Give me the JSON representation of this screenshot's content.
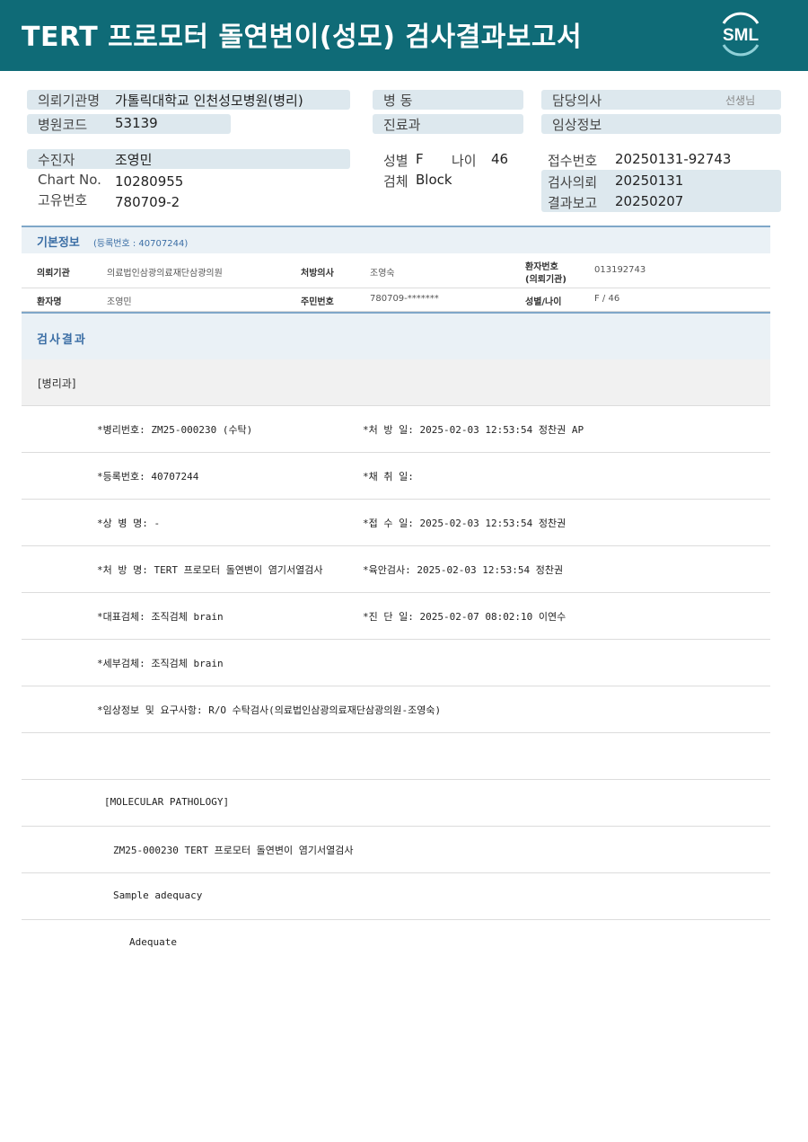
{
  "header": {
    "title": "TERT 프로모터 돌연변이(성모) 검사결과보고서",
    "logo_text": "SML",
    "bg_color": "#0f6b77"
  },
  "top": {
    "institution_label": "의뢰기관명",
    "institution_value": "가톨릭대학교 인천성모병원(병리)",
    "hospital_code_label": "병원코드",
    "hospital_code_value": "53139",
    "ward_label": "병 동",
    "department_label": "진료과",
    "doctor_label": "담당의사",
    "doctor_suffix": "선생님",
    "clinical_label": "임상정보",
    "patient_label": "수진자",
    "patient_value": "조영민",
    "chart_label": "Chart No.",
    "chart_value": "10280955",
    "unique_label": "고유번호",
    "unique_value": "780709-2",
    "sex_label": "성별",
    "sex_value": "F",
    "age_label": "나이",
    "age_value": "46",
    "specimen_label": "검체",
    "specimen_value": "Block",
    "receipt_label": "접수번호",
    "receipt_value": "20250131-92743",
    "request_label": "검사의뢰",
    "request_value": "20250131",
    "report_label": "결과보고",
    "report_value": "20250207"
  },
  "basic": {
    "title": "기본정보",
    "reg": "(등록번호 : 40707244)",
    "row1": {
      "k1": "의뢰기관",
      "v1": "의료법인삼광의료재단삼광의원",
      "k2": "처방의사",
      "v2": "조영숙",
      "k3a": "환자번호",
      "k3b": "(의뢰기관)",
      "v3": "013192743"
    },
    "row2": {
      "k1": "환자명",
      "v1": "조영민",
      "k2": "주민번호",
      "v2": "780709-*******",
      "k3": "성별/나이",
      "v3": "F / 46"
    }
  },
  "result": {
    "title": "검사결과",
    "dept": "[병리과]",
    "rows": [
      {
        "a": "*병리번호: ZM25-000230 (수탁)",
        "b": "*처 방 일: 2025-02-03 12:53:54  정찬권 AP"
      },
      {
        "a": "*등록번호: 40707244",
        "b": "*채 취 일:"
      },
      {
        "a": "*상 병 명: -",
        "b": "*접 수 일: 2025-02-03 12:53:54  정찬권"
      },
      {
        "a": "*처 방 명: TERT 프로모터 돌연변이 염기서열검사",
        "b": "*육안검사: 2025-02-03 12:53:54  정찬권"
      },
      {
        "a": "*대표검체: 조직검체 brain",
        "b": "*진 단 일: 2025-02-07 08:02:10  이연수"
      },
      {
        "a": "*세부검체: 조직검체 brain",
        "b": ""
      },
      {
        "a": "*임상정보 및 요구사항: R/O 수탁검사(의료법인삼광의료재단삼광의원-조영숙)",
        "b": ""
      },
      {
        "a": "",
        "b": ""
      },
      {
        "a": "[MOLECULAR PATHOLOGY]",
        "b": ""
      },
      {
        "a": "ZM25-000230    TERT 프로모터 돌연변이 염기서열검사",
        "b": ""
      },
      {
        "a": "Sample adequacy",
        "b": ""
      },
      {
        "a": "Adequate",
        "b": ""
      }
    ]
  }
}
